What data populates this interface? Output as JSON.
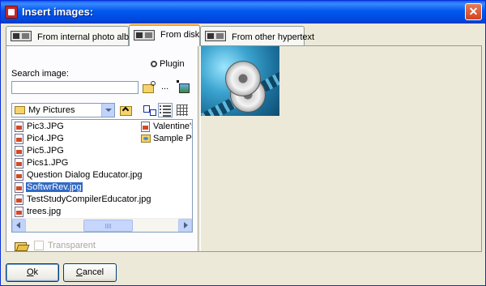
{
  "window": {
    "title": "Insert images:",
    "close_glyph": "✕"
  },
  "tabs": [
    {
      "label": "From internal photo album",
      "icon": "photo-album-icon"
    },
    {
      "label": "From disk",
      "icon": "disk-icon",
      "active": true
    },
    {
      "label": "From other hypertext",
      "icon": "hypertext-icon"
    }
  ],
  "plugin": {
    "label": "Plugin",
    "icon": "plugin-icon"
  },
  "search": {
    "label": "Search image:",
    "value": "",
    "browse_label": "..."
  },
  "folder": {
    "selected": "My Pictures"
  },
  "files": [
    {
      "name": "Pic3.JPG",
      "type": "file"
    },
    {
      "name": "Pic4.JPG",
      "type": "file"
    },
    {
      "name": "Pic5.JPG",
      "type": "file"
    },
    {
      "name": "Pics1.JPG",
      "type": "file"
    },
    {
      "name": "Question Dialog Educator.jpg",
      "type": "file"
    },
    {
      "name": "SoftwrRev.jpg",
      "type": "file",
      "selected": true
    },
    {
      "name": "TestStudyCompilerEducator.jpg",
      "type": "file"
    },
    {
      "name": "trees.jpg",
      "type": "file"
    },
    {
      "name": "Valentine's",
      "type": "file"
    },
    {
      "name": "Sample Pic",
      "type": "folder"
    }
  ],
  "scrollbar": {
    "thumb_glyph": "III"
  },
  "transparent": {
    "label": "Transparent",
    "checked": false,
    "enabled": false
  },
  "buttons": {
    "ok_underline": "O",
    "ok_rest": "k",
    "cancel_underline": "C",
    "cancel_rest": "ancel"
  },
  "colors": {
    "titlebar": "#0058ee",
    "selection": "#316ac5",
    "dialog_bg": "#ece9d8"
  }
}
